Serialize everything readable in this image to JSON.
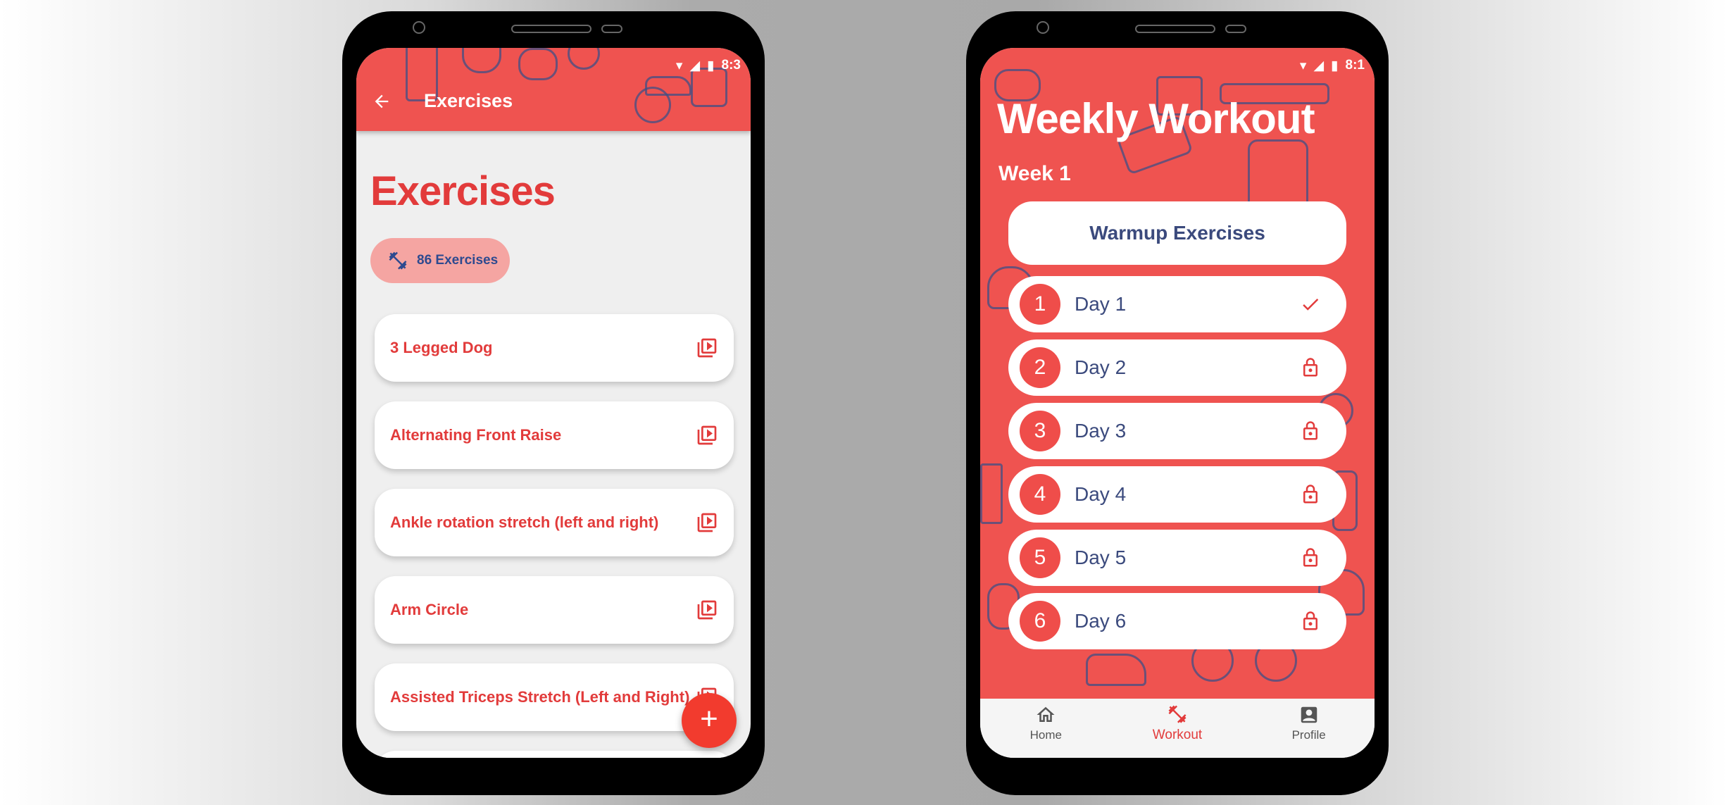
{
  "left_screen": {
    "status_time": "8:3",
    "appbar_title": "Exercises",
    "page_title": "Exercises",
    "chip_label": "86 Exercises",
    "exercises": [
      {
        "label": "3 Legged Dog"
      },
      {
        "label": "Alternating Front Raise"
      },
      {
        "label": "Ankle rotation stretch (left and right)"
      },
      {
        "label": "Arm Circle"
      },
      {
        "label": "Assisted Triceps Stretch (Left and Right)"
      }
    ],
    "fab_label": "+"
  },
  "right_screen": {
    "status_time": "8:1",
    "title": "Weekly Workout",
    "week_label": "Week 1",
    "warmup_label": "Warmup Exercises",
    "days": [
      {
        "number": "1",
        "label": "Day 1",
        "status": "completed"
      },
      {
        "number": "2",
        "label": "Day 2",
        "status": "locked"
      },
      {
        "number": "3",
        "label": "Day 3",
        "status": "locked"
      },
      {
        "number": "4",
        "label": "Day 4",
        "status": "locked"
      },
      {
        "number": "5",
        "label": "Day 5",
        "status": "locked"
      },
      {
        "number": "6",
        "label": "Day 6",
        "status": "locked"
      }
    ],
    "nav": [
      {
        "label": "Home",
        "icon": "home-icon",
        "active": false
      },
      {
        "label": "Workout",
        "icon": "dumbbell-icon",
        "active": true
      },
      {
        "label": "Profile",
        "icon": "profile-icon",
        "active": false
      }
    ]
  },
  "colors": {
    "primary_red": "#ef5350",
    "title_red": "#e23b3b",
    "navy": "#3b4a7d",
    "chip_bg": "#f5a5a2",
    "fab_red": "#f23b2e"
  }
}
